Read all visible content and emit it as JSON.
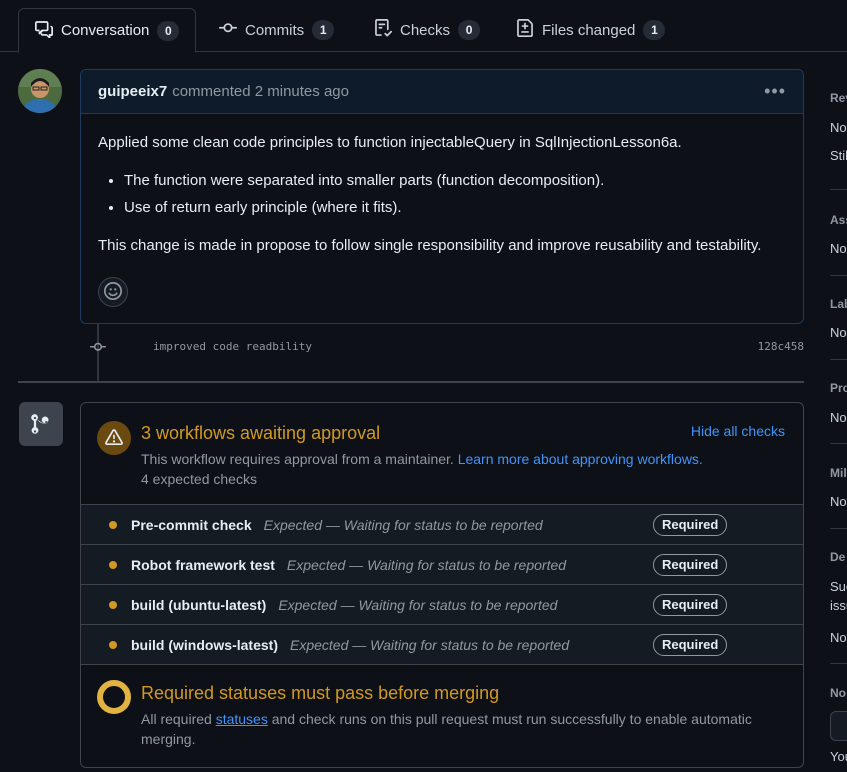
{
  "tabs": [
    {
      "label": "Conversation",
      "count": "0",
      "icon": "comment-discussion-icon"
    },
    {
      "label": "Commits",
      "count": "1",
      "icon": "git-commit-icon"
    },
    {
      "label": "Checks",
      "count": "0",
      "icon": "checklist-icon"
    },
    {
      "label": "Files changed",
      "count": "1",
      "icon": "file-diff-icon"
    }
  ],
  "comment": {
    "author": "guipeeix7",
    "meta": "commented 2 minutes ago",
    "intro": "Applied some clean code principles to function injectableQuery in SqlInjectionLesson6a.",
    "bullets": [
      "The function were separated into smaller parts (function decomposition).",
      "Use of return early principle (where it fits)."
    ],
    "outro": "This change is made in propose to follow single responsibility and improve reusability and testability."
  },
  "commit": {
    "message": "improved code readbility",
    "sha": "128c458"
  },
  "checks": {
    "title": "3 workflows awaiting approval",
    "hide_label": "Hide all checks",
    "sub_text": "This workflow requires approval from a maintainer.",
    "sub_link": "Learn more about approving workflows.",
    "expected": "4 expected checks",
    "rows": [
      {
        "name": "Pre-commit check",
        "desc": "Expected — Waiting for status to be reported",
        "badge": "Required"
      },
      {
        "name": "Robot framework test",
        "desc": "Expected — Waiting for status to be reported",
        "badge": "Required"
      },
      {
        "name": "build (ubuntu-latest)",
        "desc": "Expected — Waiting for status to be reported",
        "badge": "Required"
      },
      {
        "name": "build (windows-latest)",
        "desc": "Expected — Waiting for status to be reported",
        "badge": "Required"
      }
    ],
    "status_title": "Required statuses must pass before merging",
    "status_pre": "All required ",
    "status_link": "statuses",
    "status_post": " and check runs on this pull request must run successfully to enable automatic merging."
  },
  "sidebar": {
    "items": [
      {
        "text": "Rev",
        "kind": "head"
      },
      {
        "text": "No",
        "kind": "val"
      },
      {
        "text": "Stil",
        "kind": "val"
      },
      {
        "text": "Ass",
        "kind": "head"
      },
      {
        "text": "No",
        "kind": "val"
      },
      {
        "text": "Lab",
        "kind": "head"
      },
      {
        "text": "No",
        "kind": "val"
      },
      {
        "text": "Pro",
        "kind": "head"
      },
      {
        "text": "No",
        "kind": "val"
      },
      {
        "text": "Mil",
        "kind": "head"
      },
      {
        "text": "No",
        "kind": "val"
      },
      {
        "text": "De",
        "kind": "head"
      },
      {
        "text": "Suc",
        "kind": "val"
      },
      {
        "text": "issu",
        "kind": "val"
      },
      {
        "text": "No",
        "kind": "val"
      },
      {
        "text": "No",
        "kind": "head"
      },
      {
        "text": "You",
        "kind": "val"
      }
    ]
  },
  "colors": {
    "accent": "#4493f8",
    "warning": "#d29922",
    "background": "#0d1117"
  }
}
